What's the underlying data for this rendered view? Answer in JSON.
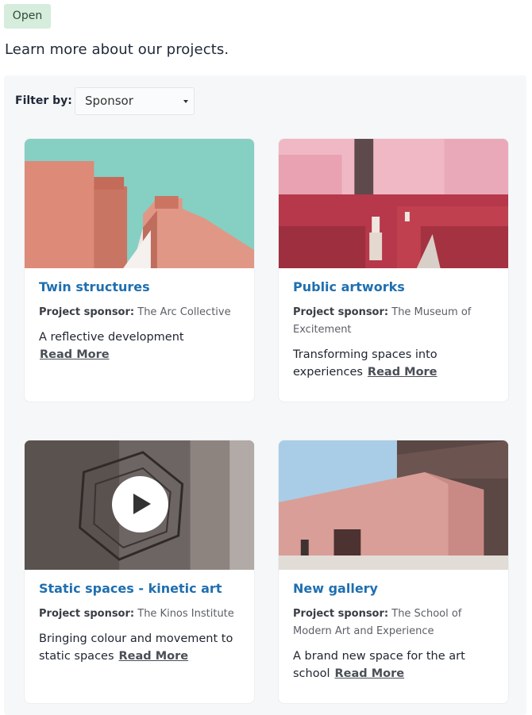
{
  "status_badge": "Open",
  "intro_text": "Learn more about our projects.",
  "filter": {
    "label": "Filter by:",
    "selected": "Sponsor"
  },
  "sponsor_label": "Project sponsor:",
  "cards": [
    {
      "title": "Twin structures",
      "sponsor": "The Arc Collective",
      "description": "A reflective development",
      "read_more": "Read More"
    },
    {
      "title": "Public artworks",
      "sponsor": "The Museum of Excitement",
      "description": "Transforming spaces into experiences",
      "read_more": "Read More"
    },
    {
      "title": "Static spaces - kinetic art",
      "sponsor": "The Kinos Institute",
      "description": "Bringing colour and movement to static spaces",
      "read_more": "Read More"
    },
    {
      "title": "New gallery",
      "sponsor": "The School of Modern Art and Experience",
      "description": "A brand new space for the art school",
      "read_more": "Read More"
    }
  ],
  "colors": {
    "title_blue": "#1f6fb0",
    "badge_bg": "#d6ecdc",
    "panel_bg": "#f6f7f9"
  },
  "icons": {
    "select_caret": "chevron-down-icon",
    "video_play": "play-icon"
  }
}
